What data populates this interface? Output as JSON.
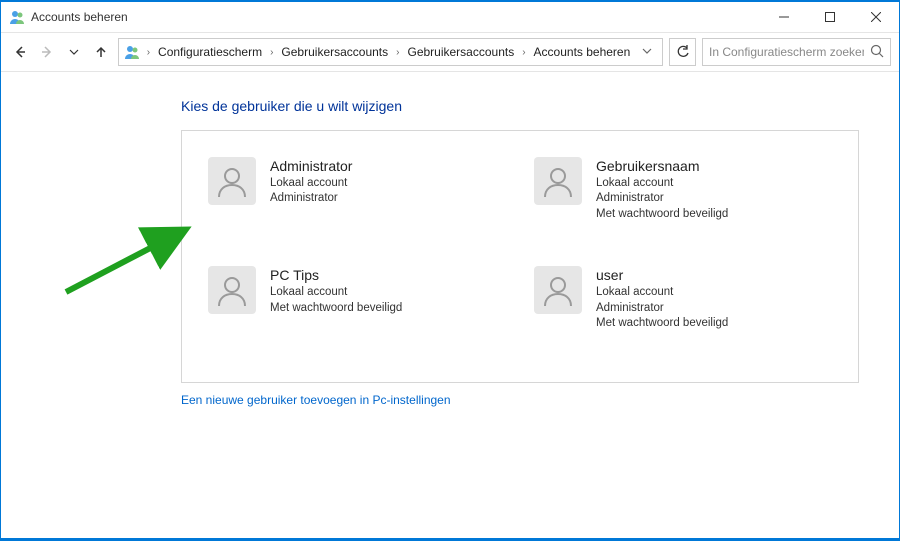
{
  "window": {
    "title": "Accounts beheren"
  },
  "breadcrumb": {
    "items": [
      {
        "label": "Configuratiescherm"
      },
      {
        "label": "Gebruikersaccounts"
      },
      {
        "label": "Gebruikersaccounts"
      },
      {
        "label": "Accounts beheren"
      }
    ]
  },
  "search": {
    "placeholder": "In Configuratiescherm zoeken"
  },
  "page": {
    "heading": "Kies de gebruiker die u wilt wijzigen",
    "add_user_link": "Een nieuwe gebruiker toevoegen in Pc-instellingen"
  },
  "accounts": [
    {
      "name": "Administrator",
      "lines": [
        "Lokaal account",
        "Administrator"
      ]
    },
    {
      "name": "Gebruikersnaam",
      "lines": [
        "Lokaal account",
        "Administrator",
        "Met wachtwoord beveiligd"
      ]
    },
    {
      "name": "PC Tips",
      "lines": [
        "Lokaal account",
        "Met wachtwoord beveiligd"
      ]
    },
    {
      "name": "user",
      "lines": [
        "Lokaal account",
        "Administrator",
        "Met wachtwoord beveiligd"
      ]
    }
  ],
  "annotation": {
    "arrow_color": "#1fa01f"
  }
}
